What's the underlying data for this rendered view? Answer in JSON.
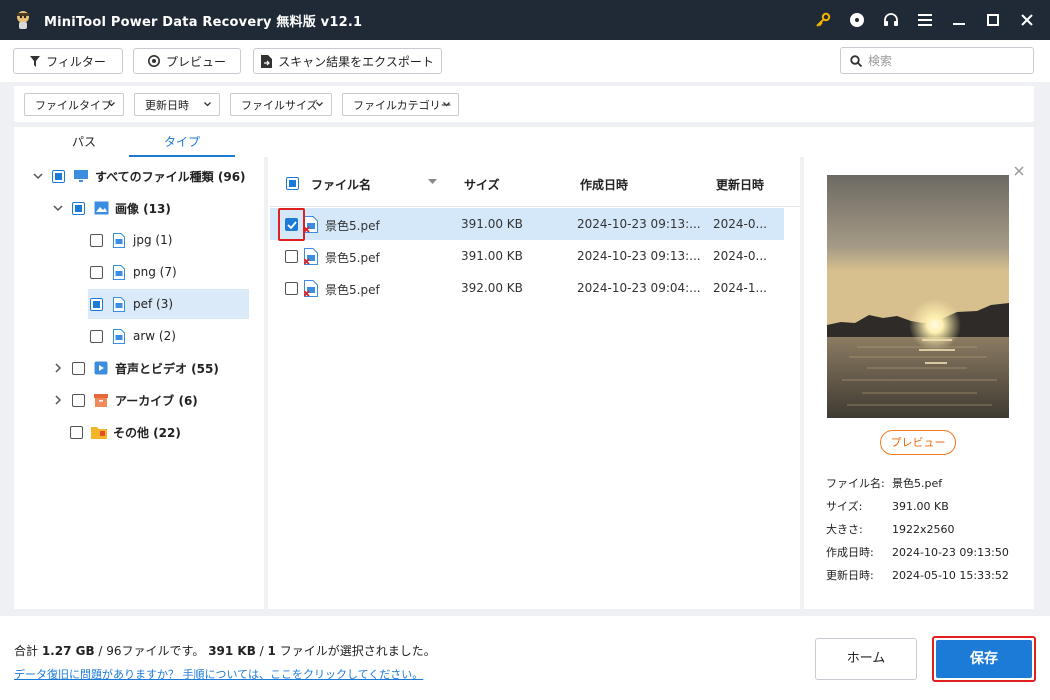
{
  "app": {
    "title": "MiniTool Power Data Recovery 無料版 v12.1"
  },
  "titlebar_icons": [
    "key-icon",
    "disc-icon",
    "headset-icon",
    "menu-icon",
    "minimize-icon",
    "maximize-icon",
    "close-icon"
  ],
  "toolbar": {
    "filter_label": "フィルター",
    "preview_label": "プレビュー",
    "export_label": "スキャン結果をエクスポート",
    "search_placeholder": "検索"
  },
  "filters": [
    {
      "label": "ファイルタイプ"
    },
    {
      "label": "更新日時"
    },
    {
      "label": "ファイルサイズ"
    },
    {
      "label": "ファイルカテゴリー"
    }
  ],
  "tabs": [
    {
      "label": "パス",
      "active": false
    },
    {
      "label": "タイプ",
      "active": true
    }
  ],
  "tree": {
    "root": {
      "label": "すべてのファイル種類 (96)"
    },
    "images": {
      "label": "画像 (13)"
    },
    "jpg": {
      "label": "jpg (1)"
    },
    "png": {
      "label": "png (7)"
    },
    "pef": {
      "label": "pef (3)"
    },
    "arw": {
      "label": "arw (2)"
    },
    "av": {
      "label": "音声とビデオ (55)"
    },
    "archive": {
      "label": "アーカイブ (6)"
    },
    "other": {
      "label": "その他 (22)"
    }
  },
  "list": {
    "headers": {
      "name": "ファイル名",
      "size": "サイズ",
      "created": "作成日時",
      "modified": "更新日時"
    },
    "rows": [
      {
        "name": "景色5.pef",
        "size": "391.00 KB",
        "created": "2024-10-23 09:13:...",
        "modified": "2024-0...",
        "checked": true
      },
      {
        "name": "景色5.pef",
        "size": "391.00 KB",
        "created": "2024-10-23 09:13:...",
        "modified": "2024-0...",
        "checked": false
      },
      {
        "name": "景色5.pef",
        "size": "392.00 KB",
        "created": "2024-10-23 09:04:...",
        "modified": "2024-1...",
        "checked": false
      }
    ]
  },
  "preview": {
    "button_label": "プレビュー",
    "meta": [
      {
        "key": "ファイル名:",
        "value": "景色5.pef"
      },
      {
        "key": "サイズ:",
        "value": "391.00 KB"
      },
      {
        "key": "大きさ:",
        "value": "1922x2560"
      },
      {
        "key": "作成日時:",
        "value": "2024-10-23 09:13:50"
      },
      {
        "key": "更新日時:",
        "value": "2024-05-10 15:33:52"
      }
    ]
  },
  "bottom": {
    "summary_prefix": "合計 ",
    "total_size": "1.27 GB",
    "summary_mid": " / 96ファイルです。",
    "selected_size": "391 KB",
    "summary_sep": " / ",
    "selected_count": "1",
    "summary_suffix": " ファイルが選択されました。",
    "help_link": "データ復旧に問題がありますか？ 手順については、ここをクリックしてください。",
    "home_label": "ホーム",
    "save_label": "保存"
  },
  "colors": {
    "accent": "#1d7bd8",
    "titlebar": "#1f2a36",
    "highlight": "#e02020",
    "preview_button": "#f07a20"
  }
}
